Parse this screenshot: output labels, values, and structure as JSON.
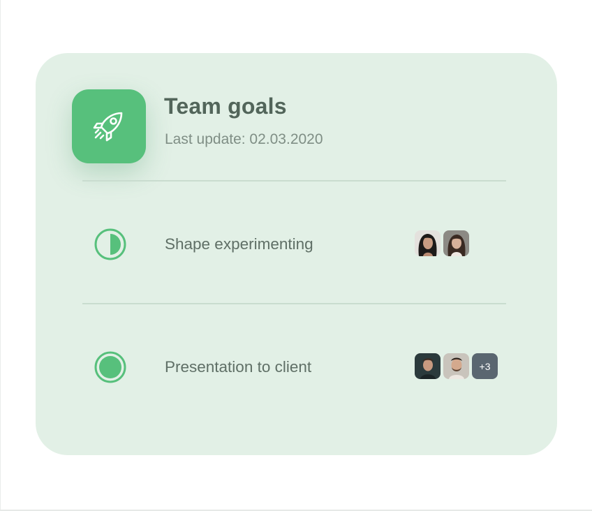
{
  "card": {
    "title": "Team goals",
    "last_update": "Last update: 02.03.2020",
    "icon": "rocket-icon",
    "accent_color": "#57c07c",
    "background_color": "#e2f0e6"
  },
  "goals": [
    {
      "label": "Shape experimenting",
      "status": "half-complete",
      "status_icon": "half-circle-progress-icon",
      "avatars": [
        "avatar-woman-dark-hair",
        "avatar-woman-long-hair"
      ]
    },
    {
      "label": "Presentation to client",
      "status": "complete",
      "status_icon": "filled-circle-complete-icon",
      "avatars": [
        "avatar-man-dark",
        "avatar-man-beard"
      ],
      "more_count": "+3"
    }
  ]
}
